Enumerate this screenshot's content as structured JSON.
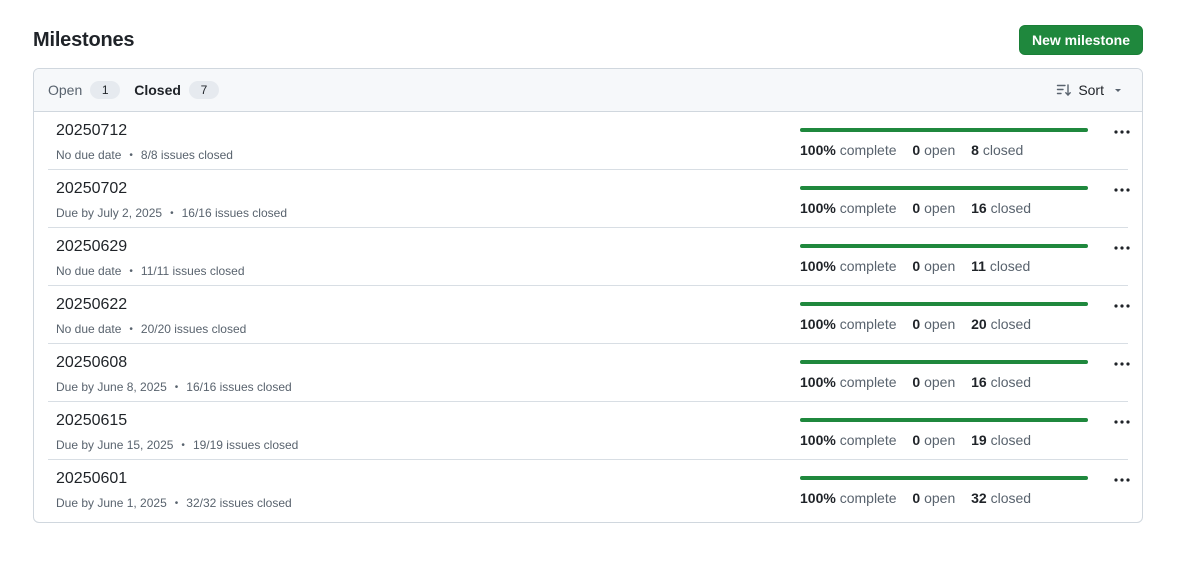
{
  "header": {
    "title": "Milestones",
    "new_button": "New milestone"
  },
  "tabs": [
    {
      "label": "Open",
      "count": "1",
      "selected": false
    },
    {
      "label": "Closed",
      "count": "7",
      "selected": true
    }
  ],
  "sort": {
    "label": "Sort"
  },
  "stat_labels": {
    "complete": "complete",
    "open": "open",
    "closed": "closed"
  },
  "colors": {
    "accent": "#1f883d",
    "border": "#d0d7de",
    "muted": "#59636e"
  },
  "milestones": [
    {
      "name": "20250712",
      "due": "No due date",
      "issues": "8/8 issues closed",
      "percent": "100%",
      "progress": 1.0,
      "open": "0",
      "closed": "8"
    },
    {
      "name": "20250702",
      "due": "Due by July 2, 2025",
      "issues": "16/16 issues closed",
      "percent": "100%",
      "progress": 1.0,
      "open": "0",
      "closed": "16"
    },
    {
      "name": "20250629",
      "due": "No due date",
      "issues": "11/11 issues closed",
      "percent": "100%",
      "progress": 1.0,
      "open": "0",
      "closed": "11"
    },
    {
      "name": "20250622",
      "due": "No due date",
      "issues": "20/20 issues closed",
      "percent": "100%",
      "progress": 1.0,
      "open": "0",
      "closed": "20"
    },
    {
      "name": "20250608",
      "due": "Due by June 8, 2025",
      "issues": "16/16 issues closed",
      "percent": "100%",
      "progress": 1.0,
      "open": "0",
      "closed": "16"
    },
    {
      "name": "20250615",
      "due": "Due by June 15, 2025",
      "issues": "19/19 issues closed",
      "percent": "100%",
      "progress": 1.0,
      "open": "0",
      "closed": "19"
    },
    {
      "name": "20250601",
      "due": "Due by June 1, 2025",
      "issues": "32/32 issues closed",
      "percent": "100%",
      "progress": 1.0,
      "open": "0",
      "closed": "32"
    }
  ]
}
